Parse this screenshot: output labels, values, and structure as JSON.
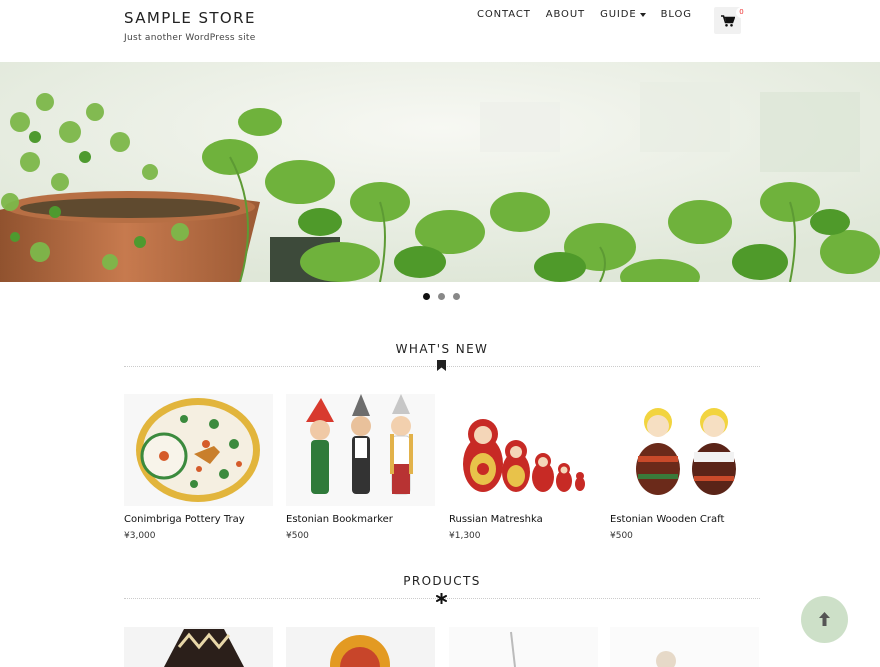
{
  "site": {
    "title": "SAMPLE STORE",
    "description": "Just another WordPress site"
  },
  "nav": {
    "items": [
      "CONTACT",
      "ABOUT",
      "GUIDE",
      "BLOG"
    ]
  },
  "cart": {
    "count": "0"
  },
  "slider": {
    "slide_count": 3,
    "active_index": 0
  },
  "whats_new": {
    "title": "WHAT'S NEW",
    "products": [
      {
        "name": "Conimbriga Pottery Tray",
        "price": "¥3,000"
      },
      {
        "name": "Estonian Bookmarker",
        "price": "¥500"
      },
      {
        "name": "Russian Matreshka",
        "price": "¥1,300"
      },
      {
        "name": "Estonian Wooden Craft",
        "price": "¥500"
      }
    ]
  },
  "products_section": {
    "title": "PRODUCTS"
  },
  "icons": {
    "cart": "shopping-cart-icon",
    "bookmark": "bookmark-icon",
    "asterisk": "asterisk-icon",
    "scroll_top": "arrow-up-icon"
  },
  "colors": {
    "scroll_top_bg": "#cde0c8",
    "badge_text": "#e33333"
  }
}
